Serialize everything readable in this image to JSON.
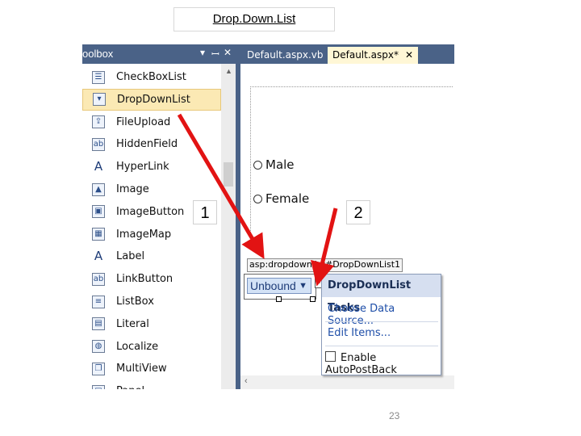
{
  "slide": {
    "title": "Drop.Down.List",
    "page_number": "23"
  },
  "toolbox": {
    "title": "oolbox",
    "controls": [
      "▾",
      "ꟷ",
      "✕"
    ],
    "items": [
      {
        "label": "CheckBoxList",
        "icon": "checkboxlist-icon",
        "glyph": "☰"
      },
      {
        "label": "DropDownList",
        "icon": "dropdownlist-icon",
        "glyph": "▾",
        "selected": true
      },
      {
        "label": "FileUpload",
        "icon": "fileupload-icon",
        "glyph": "⇪"
      },
      {
        "label": "HiddenField",
        "icon": "hiddenfield-icon",
        "glyph": "ab"
      },
      {
        "label": "HyperLink",
        "icon": "hyperlink-icon",
        "glyph": "A"
      },
      {
        "label": "Image",
        "icon": "image-icon",
        "glyph": "▲"
      },
      {
        "label": "ImageButton",
        "icon": "imagebutton-icon",
        "glyph": "▣"
      },
      {
        "label": "ImageMap",
        "icon": "imagemap-icon",
        "glyph": "▦"
      },
      {
        "label": "Label",
        "icon": "label-icon",
        "glyph": "A"
      },
      {
        "label": "LinkButton",
        "icon": "linkbutton-icon",
        "glyph": "ab"
      },
      {
        "label": "ListBox",
        "icon": "listbox-icon",
        "glyph": "≡"
      },
      {
        "label": "Literal",
        "icon": "literal-icon",
        "glyph": "▤"
      },
      {
        "label": "Localize",
        "icon": "localize-icon",
        "glyph": "◍"
      },
      {
        "label": "MultiView",
        "icon": "multiview-icon",
        "glyph": "❐"
      },
      {
        "label": "Panel",
        "icon": "panel-icon",
        "glyph": "□"
      }
    ]
  },
  "editor": {
    "tabs": [
      {
        "label": "Default.aspx.vb",
        "active": false
      },
      {
        "label": "Default.aspx*",
        "active": true,
        "close": "✕"
      }
    ],
    "radios": [
      "Male",
      "Female"
    ],
    "control_tag": "asp:dropdownlist#DropDownList1",
    "dropdown": {
      "value": "Unbound",
      "arrow": "▼"
    },
    "smart_tag": "‹"
  },
  "tasks_panel": {
    "title": "DropDownList Tasks",
    "links": [
      "Choose Data Source...",
      "Edit Items..."
    ],
    "checkbox_label": "Enable AutoPostBack",
    "checkbox_checked": false
  },
  "callouts": [
    "1",
    "2"
  ],
  "colors": {
    "arrow": "#e21313",
    "header": "#4a6287",
    "selected": "#fbe9b4"
  }
}
